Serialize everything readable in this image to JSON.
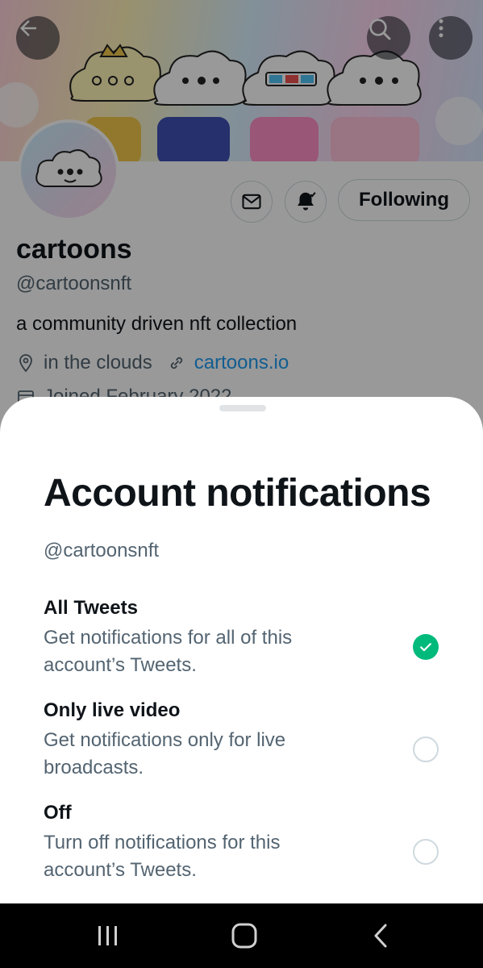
{
  "profile": {
    "name": "cartoons",
    "handle": "@cartoonsnft",
    "bio": "a community driven nft collection",
    "location": "in the clouds",
    "website": "cartoons.io",
    "joined": "Joined February 2022",
    "follow_label": "Following"
  },
  "sheet": {
    "title": "Account notifications",
    "handle": "@cartoonsnft",
    "options": [
      {
        "title": "All Tweets",
        "description": "Get notifications for all of this account’s Tweets.",
        "selected": true
      },
      {
        "title": "Only live video",
        "description": "Get notifications only for live broadcasts.",
        "selected": false
      },
      {
        "title": "Off",
        "description": "Turn off notifications for this account’s Tweets.",
        "selected": false
      }
    ]
  },
  "colors": {
    "accent_green": "#00ba7c",
    "link_blue": "#1d9bf0",
    "text_gray": "#536471"
  },
  "icons": [
    "back-arrow-icon",
    "search-icon",
    "more-vertical-icon",
    "mail-icon",
    "bell-check-icon",
    "location-pin-icon",
    "link-icon",
    "calendar-icon",
    "check-icon",
    "recents-icon",
    "home-icon",
    "nav-back-icon"
  ]
}
